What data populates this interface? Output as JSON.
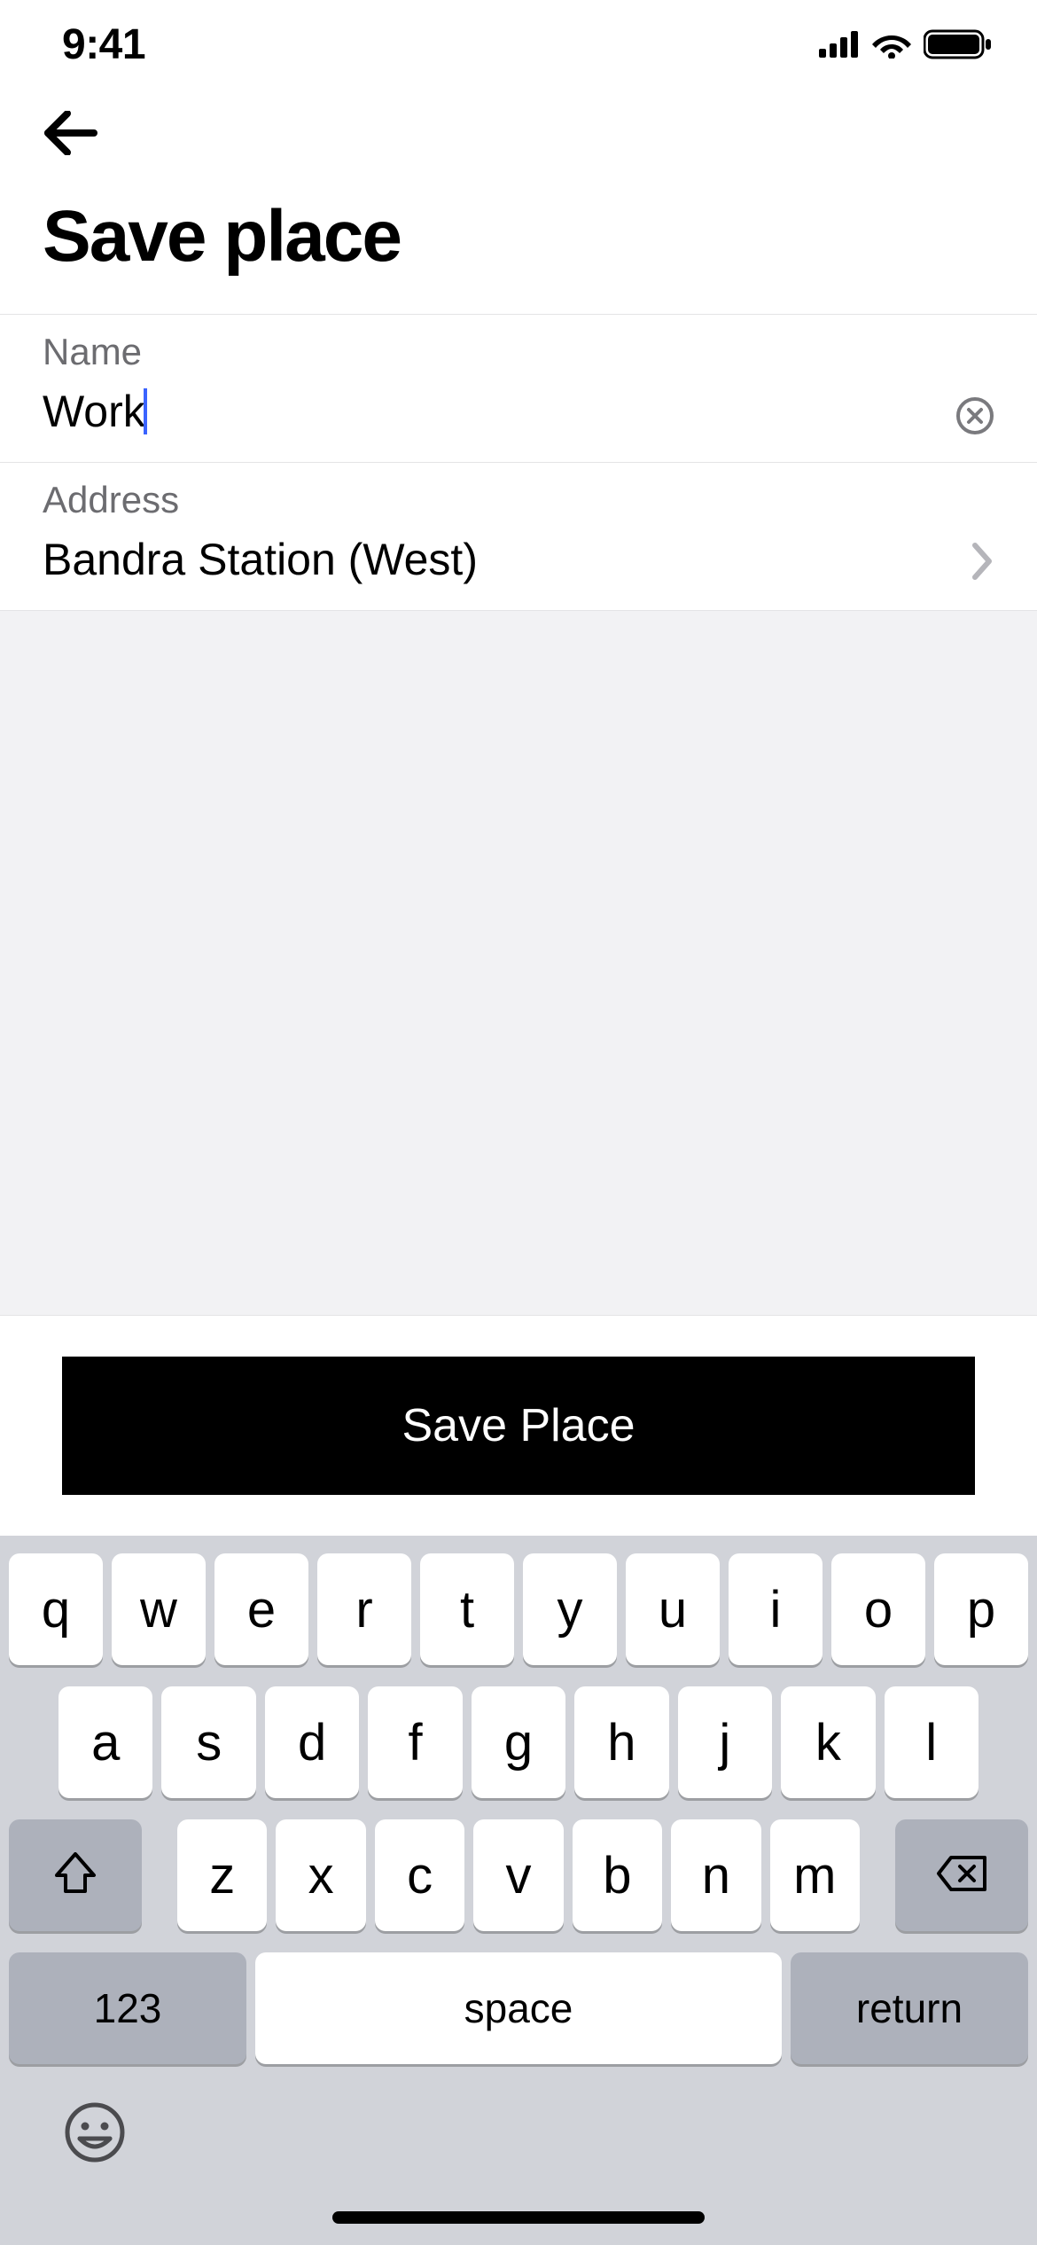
{
  "status_bar": {
    "time": "9:41"
  },
  "header": {
    "title": "Save place"
  },
  "fields": {
    "name": {
      "label": "Name",
      "value": "Work"
    },
    "address": {
      "label": "Address",
      "value": "Bandra Station (West)"
    }
  },
  "action": {
    "save_label": "Save Place"
  },
  "keyboard": {
    "row1": [
      "q",
      "w",
      "e",
      "r",
      "t",
      "y",
      "u",
      "i",
      "o",
      "p"
    ],
    "row2": [
      "a",
      "s",
      "d",
      "f",
      "g",
      "h",
      "j",
      "k",
      "l"
    ],
    "row3": [
      "z",
      "x",
      "c",
      "v",
      "b",
      "n",
      "m"
    ],
    "numeric_label": "123",
    "space_label": "space",
    "return_label": "return"
  }
}
